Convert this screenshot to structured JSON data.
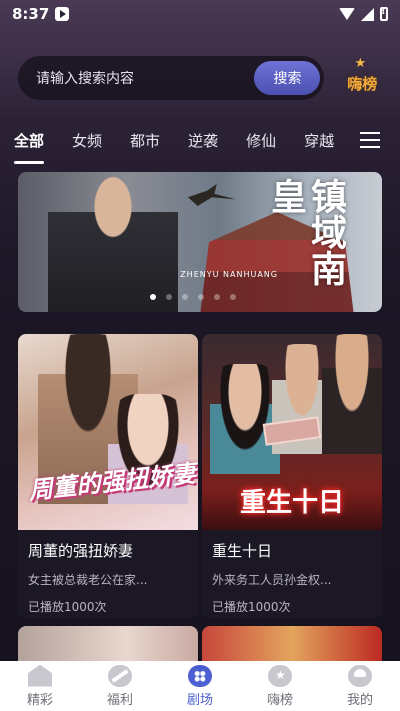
{
  "status_bar": {
    "time": "8:37"
  },
  "search": {
    "placeholder": "请输入搜索内容",
    "button_label": "搜索",
    "hot_rank_label": "嗨榜"
  },
  "tabs": [
    {
      "label": "全部",
      "active": true
    },
    {
      "label": "女频",
      "active": false
    },
    {
      "label": "都市",
      "active": false
    },
    {
      "label": "逆袭",
      "active": false
    },
    {
      "label": "修仙",
      "active": false
    },
    {
      "label": "穿越",
      "active": false
    }
  ],
  "banner": {
    "title": "镇域南皇",
    "subtitle": "ZHENYU NANHUANG",
    "dot_count": 6,
    "active_dot": 0
  },
  "cards": [
    {
      "poster_text": "周董的强扭娇妻",
      "title": "周董的强扭娇妻",
      "description": "女主被总裁老公在家...",
      "plays": "已播放1000次"
    },
    {
      "poster_text": "重生十日",
      "title": "重生十日",
      "description": "外来务工人员孙金权...",
      "plays": "已播放1000次"
    }
  ],
  "bottom_nav": [
    {
      "label": "精彩",
      "icon": "home-icon",
      "active": false
    },
    {
      "label": "福利",
      "icon": "gift-icon",
      "active": false
    },
    {
      "label": "剧场",
      "icon": "theater-icon",
      "active": true
    },
    {
      "label": "嗨榜",
      "icon": "medal-icon",
      "active": false
    },
    {
      "label": "我的",
      "icon": "profile-icon",
      "active": false
    }
  ],
  "colors": {
    "accent": "#4b5fd0",
    "search_button": "#5b5fc4",
    "hot_rank": "#f2a93b"
  }
}
